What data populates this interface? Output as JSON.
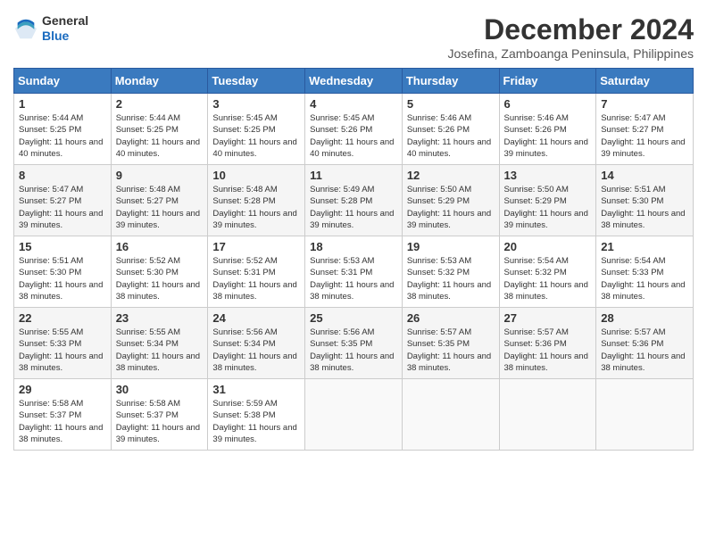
{
  "logo": {
    "general": "General",
    "blue": "Blue"
  },
  "title": "December 2024",
  "location": "Josefina, Zamboanga Peninsula, Philippines",
  "weekdays": [
    "Sunday",
    "Monday",
    "Tuesday",
    "Wednesday",
    "Thursday",
    "Friday",
    "Saturday"
  ],
  "weeks": [
    [
      {
        "day": "1",
        "sunrise": "5:44 AM",
        "sunset": "5:25 PM",
        "daylight": "11 hours and 40 minutes."
      },
      {
        "day": "2",
        "sunrise": "5:44 AM",
        "sunset": "5:25 PM",
        "daylight": "11 hours and 40 minutes."
      },
      {
        "day": "3",
        "sunrise": "5:45 AM",
        "sunset": "5:25 PM",
        "daylight": "11 hours and 40 minutes."
      },
      {
        "day": "4",
        "sunrise": "5:45 AM",
        "sunset": "5:26 PM",
        "daylight": "11 hours and 40 minutes."
      },
      {
        "day": "5",
        "sunrise": "5:46 AM",
        "sunset": "5:26 PM",
        "daylight": "11 hours and 40 minutes."
      },
      {
        "day": "6",
        "sunrise": "5:46 AM",
        "sunset": "5:26 PM",
        "daylight": "11 hours and 39 minutes."
      },
      {
        "day": "7",
        "sunrise": "5:47 AM",
        "sunset": "5:27 PM",
        "daylight": "11 hours and 39 minutes."
      }
    ],
    [
      {
        "day": "8",
        "sunrise": "5:47 AM",
        "sunset": "5:27 PM",
        "daylight": "11 hours and 39 minutes."
      },
      {
        "day": "9",
        "sunrise": "5:48 AM",
        "sunset": "5:27 PM",
        "daylight": "11 hours and 39 minutes."
      },
      {
        "day": "10",
        "sunrise": "5:48 AM",
        "sunset": "5:28 PM",
        "daylight": "11 hours and 39 minutes."
      },
      {
        "day": "11",
        "sunrise": "5:49 AM",
        "sunset": "5:28 PM",
        "daylight": "11 hours and 39 minutes."
      },
      {
        "day": "12",
        "sunrise": "5:50 AM",
        "sunset": "5:29 PM",
        "daylight": "11 hours and 39 minutes."
      },
      {
        "day": "13",
        "sunrise": "5:50 AM",
        "sunset": "5:29 PM",
        "daylight": "11 hours and 39 minutes."
      },
      {
        "day": "14",
        "sunrise": "5:51 AM",
        "sunset": "5:30 PM",
        "daylight": "11 hours and 38 minutes."
      }
    ],
    [
      {
        "day": "15",
        "sunrise": "5:51 AM",
        "sunset": "5:30 PM",
        "daylight": "11 hours and 38 minutes."
      },
      {
        "day": "16",
        "sunrise": "5:52 AM",
        "sunset": "5:30 PM",
        "daylight": "11 hours and 38 minutes."
      },
      {
        "day": "17",
        "sunrise": "5:52 AM",
        "sunset": "5:31 PM",
        "daylight": "11 hours and 38 minutes."
      },
      {
        "day": "18",
        "sunrise": "5:53 AM",
        "sunset": "5:31 PM",
        "daylight": "11 hours and 38 minutes."
      },
      {
        "day": "19",
        "sunrise": "5:53 AM",
        "sunset": "5:32 PM",
        "daylight": "11 hours and 38 minutes."
      },
      {
        "day": "20",
        "sunrise": "5:54 AM",
        "sunset": "5:32 PM",
        "daylight": "11 hours and 38 minutes."
      },
      {
        "day": "21",
        "sunrise": "5:54 AM",
        "sunset": "5:33 PM",
        "daylight": "11 hours and 38 minutes."
      }
    ],
    [
      {
        "day": "22",
        "sunrise": "5:55 AM",
        "sunset": "5:33 PM",
        "daylight": "11 hours and 38 minutes."
      },
      {
        "day": "23",
        "sunrise": "5:55 AM",
        "sunset": "5:34 PM",
        "daylight": "11 hours and 38 minutes."
      },
      {
        "day": "24",
        "sunrise": "5:56 AM",
        "sunset": "5:34 PM",
        "daylight": "11 hours and 38 minutes."
      },
      {
        "day": "25",
        "sunrise": "5:56 AM",
        "sunset": "5:35 PM",
        "daylight": "11 hours and 38 minutes."
      },
      {
        "day": "26",
        "sunrise": "5:57 AM",
        "sunset": "5:35 PM",
        "daylight": "11 hours and 38 minutes."
      },
      {
        "day": "27",
        "sunrise": "5:57 AM",
        "sunset": "5:36 PM",
        "daylight": "11 hours and 38 minutes."
      },
      {
        "day": "28",
        "sunrise": "5:57 AM",
        "sunset": "5:36 PM",
        "daylight": "11 hours and 38 minutes."
      }
    ],
    [
      {
        "day": "29",
        "sunrise": "5:58 AM",
        "sunset": "5:37 PM",
        "daylight": "11 hours and 38 minutes."
      },
      {
        "day": "30",
        "sunrise": "5:58 AM",
        "sunset": "5:37 PM",
        "daylight": "11 hours and 39 minutes."
      },
      {
        "day": "31",
        "sunrise": "5:59 AM",
        "sunset": "5:38 PM",
        "daylight": "11 hours and 39 minutes."
      },
      null,
      null,
      null,
      null
    ]
  ]
}
